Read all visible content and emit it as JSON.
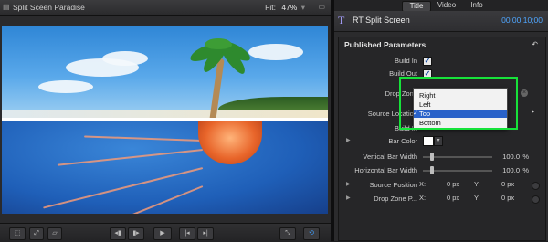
{
  "viewer": {
    "title": "Split Sceen Paradise",
    "fit_label": "Fit:",
    "fit_value": "47%",
    "transport": [
      "⬚",
      "⤢",
      "▱",
      "◂▮",
      "▮▸",
      "▶",
      "|◂",
      "▸|",
      "⤡",
      "⟲"
    ]
  },
  "inspector": {
    "tabs": [
      "Title",
      "Video",
      "Info"
    ],
    "active_tab": "Title",
    "effect_name": "RT Split Screen",
    "timecode": "00:00:10;00",
    "section_title": "Published Parameters",
    "params": {
      "build_in": "Build In",
      "build_out": "Build Out",
      "drop_zone": "Drop Zone",
      "source_location": "Source Location",
      "build_in_dup": "Build In",
      "bar_color": "Bar Color",
      "vertical_bar_width": "Vertical Bar Width",
      "horizontal_bar_width": "Horizontal Bar Width",
      "source_position": "Source Position",
      "drop_zone_p": "Drop Zone P..."
    },
    "values": {
      "vertical_bar_width": "100.0",
      "horizontal_bar_width": "100.0",
      "percent": "%",
      "x_label": "X:",
      "y_label": "Y:",
      "px_zero": "0 px"
    },
    "bar_color_hex": "#ffffff",
    "dropdown": {
      "items": [
        "Right",
        "Left",
        "Top",
        "Bottom"
      ],
      "selected": "Top",
      "checkmark": "✓"
    }
  }
}
